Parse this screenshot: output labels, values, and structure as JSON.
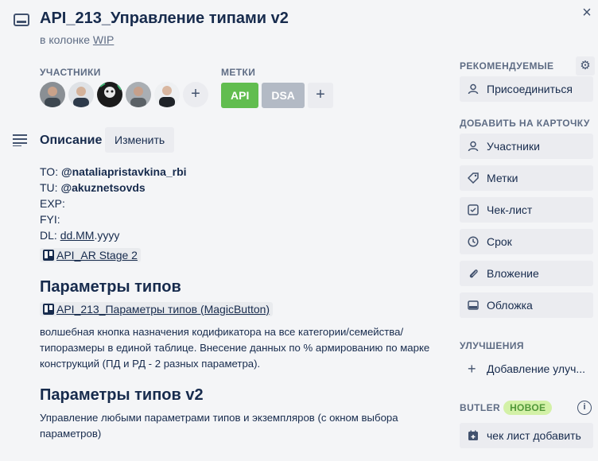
{
  "card": {
    "title": "API_213_Управление типами v2",
    "in_list_prefix": "в колонке",
    "list_name": "WIP",
    "close_label": "×"
  },
  "members_section": {
    "heading": "УЧАСТНИКИ",
    "add_label": "+"
  },
  "labels_section": {
    "heading": "МЕТКИ",
    "labels": [
      {
        "text": "API",
        "color": "#61bd4f"
      },
      {
        "text": "DSA",
        "color": "#b3bac5"
      }
    ],
    "add_label": "+"
  },
  "description": {
    "heading": "Описание",
    "edit_label": "Изменить",
    "lines": {
      "to_prefix": "TO: ",
      "to_user": "@nataliapristavkina_rbi",
      "tu_prefix": "TU: ",
      "tu_user": "@akuznetsovds",
      "exp": "EXP:",
      "fyi": "FYI:",
      "dl_prefix": "DL: ",
      "dl_value": "dd.MM",
      "dl_suffix": ".yyyy"
    },
    "link1": "API_AR Stage 2",
    "section1_title": "Параметры типов",
    "link2": "API_213_Параметры типов (MagicButton)",
    "section1_text": "волшебная кнопка назначения кодификатора на все категории/семейства/типоразмеры в единой таблице. Внесение данных по % армированию по марке конструкций (ПД и РД - 2 разных параметра).",
    "section2_title": "Параметры типов v2",
    "section2_text": "Управление любыми параметрами типов и экземпляров (с окном выбора параметров)"
  },
  "sidebar": {
    "suggested_heading": "РЕКОМЕНДУЕМЫЕ",
    "join_label": "Присоединиться",
    "add_to_card_heading": "ДОБАВИТЬ НА КАРТОЧКУ",
    "add_items": [
      {
        "label": "Участники",
        "icon": "person-icon"
      },
      {
        "label": "Метки",
        "icon": "tag-icon"
      },
      {
        "label": "Чек-лист",
        "icon": "checklist-icon"
      },
      {
        "label": "Срок",
        "icon": "clock-icon"
      },
      {
        "label": "Вложение",
        "icon": "paperclip-icon"
      },
      {
        "label": "Обложка",
        "icon": "cover-icon"
      }
    ],
    "powerups_heading": "УЛУЧШЕНИЯ",
    "add_powerup_label": "Добавление улуч...",
    "butler_heading": "BUTLER",
    "butler_badge": "НОВОЕ",
    "butler_button": "чек лист добавить"
  }
}
